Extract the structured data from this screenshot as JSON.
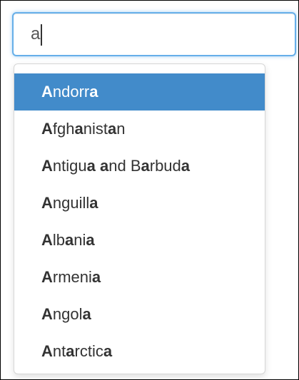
{
  "search": {
    "value": "a",
    "focused": true
  },
  "dropdown": {
    "active_index": 0,
    "items": [
      "Andorra",
      "Afghanistan",
      "Antigua and Barbuda",
      "Anguilla",
      "Albania",
      "Armenia",
      "Angola",
      "Antarctica"
    ]
  },
  "colors": {
    "focus_border": "#66afe9",
    "active_background": "#428bca",
    "active_text": "#ffffff",
    "text": "#333333"
  }
}
